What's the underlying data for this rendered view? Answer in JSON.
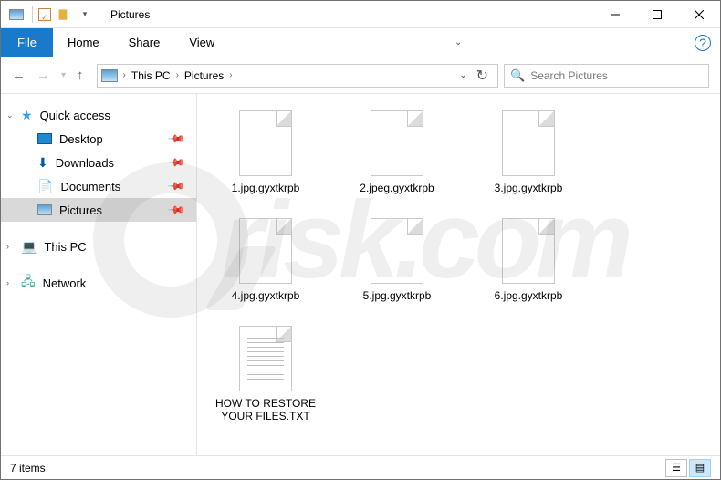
{
  "titlebar": {
    "title": "Pictures"
  },
  "ribbon": {
    "file": "File",
    "tabs": [
      "Home",
      "Share",
      "View"
    ]
  },
  "breadcrumb": {
    "root": "This PC",
    "folder": "Pictures"
  },
  "search": {
    "placeholder": "Search Pictures"
  },
  "sidebar": {
    "quick_access": "Quick access",
    "items": [
      {
        "label": "Desktop",
        "icon": "desktop",
        "pinned": true
      },
      {
        "label": "Downloads",
        "icon": "downloads",
        "pinned": true
      },
      {
        "label": "Documents",
        "icon": "documents",
        "pinned": true
      },
      {
        "label": "Pictures",
        "icon": "pictures",
        "pinned": true
      }
    ],
    "this_pc": "This PC",
    "network": "Network"
  },
  "files": [
    {
      "name": "1.jpg.gyxtkrpb",
      "type": "blank"
    },
    {
      "name": "2.jpeg.gyxtkrpb",
      "type": "blank"
    },
    {
      "name": "3.jpg.gyxtkrpb",
      "type": "blank"
    },
    {
      "name": "4.jpg.gyxtkrpb",
      "type": "blank"
    },
    {
      "name": "5.jpg.gyxtkrpb",
      "type": "blank"
    },
    {
      "name": "6.jpg.gyxtkrpb",
      "type": "blank"
    },
    {
      "name": "HOW TO RESTORE YOUR FILES.TXT",
      "type": "text"
    }
  ],
  "status": {
    "count_label": "7 items"
  },
  "watermark": {
    "text": "risk.com"
  }
}
